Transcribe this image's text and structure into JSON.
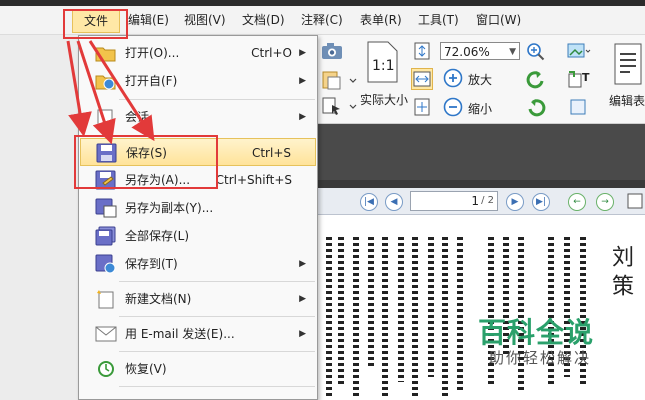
{
  "menubar": {
    "items": [
      {
        "label": "文件"
      },
      {
        "label": "编辑(E)"
      },
      {
        "label": "视图(V)"
      },
      {
        "label": "文档(D)"
      },
      {
        "label": "注释(C)"
      },
      {
        "label": "表单(R)"
      },
      {
        "label": "工具(T)"
      },
      {
        "label": "窗口(W)"
      }
    ]
  },
  "file_menu": {
    "items": [
      {
        "label": "打开(O)...",
        "shortcut": "Ctrl+O",
        "submenu": true,
        "icon": "open-folder-icon"
      },
      {
        "label": "打开自(F)",
        "shortcut": "",
        "submenu": true,
        "icon": "open-from-icon"
      },
      {
        "label": "会话",
        "shortcut": "",
        "submenu": true,
        "icon": "session-icon"
      },
      {
        "label": "保存(S)",
        "shortcut": "Ctrl+S",
        "submenu": false,
        "icon": "save-icon"
      },
      {
        "label": "另存为(A)...",
        "shortcut": "Ctrl+Shift+S",
        "submenu": false,
        "icon": "save-as-icon"
      },
      {
        "label": "另存为副本(Y)...",
        "shortcut": "",
        "submenu": false,
        "icon": "save-copy-icon"
      },
      {
        "label": "全部保存(L)",
        "shortcut": "",
        "submenu": false,
        "icon": "save-all-icon"
      },
      {
        "label": "保存到(T)",
        "shortcut": "",
        "submenu": true,
        "icon": "save-to-icon"
      },
      {
        "label": "新建文档(N)",
        "shortcut": "",
        "submenu": true,
        "icon": "new-document-icon"
      },
      {
        "label": "用 E-mail 发送(E)...",
        "shortcut": "",
        "submenu": true,
        "icon": "email-icon"
      },
      {
        "label": "恢复(V)",
        "shortcut": "",
        "submenu": false,
        "icon": "revert-icon"
      }
    ]
  },
  "toolbar": {
    "zoom_value": "72.06%",
    "actual_size_label": "实际大小",
    "zoom_in_label": "放大",
    "zoom_out_label": "缩小",
    "edit_label": "编辑表"
  },
  "navigation": {
    "page_current": "1",
    "page_total": "/ 2"
  },
  "document_text": {
    "title_chars": "刘 策"
  },
  "watermark": {
    "title": "百科全说",
    "subtitle": "助你轻松解决"
  },
  "colors": {
    "highlight_red": "#e23a3a",
    "menu_hover": "#ffe39a",
    "watermark_green": "#2aa06b"
  }
}
